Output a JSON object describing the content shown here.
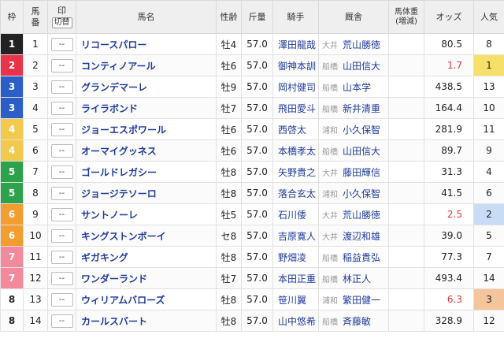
{
  "headers": {
    "waku": "枠",
    "umaban": "馬\n番",
    "mark": "印",
    "toggle": "切替",
    "horse": "馬名",
    "sexage": "性齢",
    "weight": "斤量",
    "jockey": "騎手",
    "trainer": "厩舎",
    "bodyweight": "馬体重\n(増減)",
    "odds": "オッズ",
    "pop": "人気"
  },
  "colors": {
    "waku": [
      "#ffffff",
      "#222222",
      "#e8334a",
      "#e8334a",
      "#2b5fc7",
      "#2b5fc7",
      "#f2c94c",
      "#f2c94c",
      "#2ca24a",
      "#2ca24a",
      "#f39c2f",
      "#f39c2f",
      "#f3899b",
      "#f3899b"
    ],
    "waku_text": [
      "#222222",
      "#ffffff",
      "#ffffff",
      "#ffffff",
      "#ffffff",
      "#ffffff",
      "#ffffff",
      "#ffffff",
      "#ffffff",
      "#ffffff",
      "#ffffff",
      "#ffffff",
      "#ffffff",
      "#ffffff"
    ],
    "pop1": "#f7e06a",
    "pop2": "#c9dcf5",
    "pop3": "#f4c49a"
  },
  "rows": [
    {
      "waku": "1",
      "umaban": "1",
      "mark": "--",
      "horse": "リコースパロー",
      "sexage": "牡4",
      "weight": "57.0",
      "jockey": "澤田龍哉",
      "reg": "大井",
      "trainer": "荒山勝徳",
      "bodyweight": "",
      "odds": "80.5",
      "pop": "8"
    },
    {
      "waku": "2",
      "umaban": "2",
      "mark": "--",
      "horse": "コンティノアール",
      "sexage": "牡6",
      "weight": "57.0",
      "jockey": "御神本訓",
      "reg": "船橋",
      "trainer": "山田信大",
      "bodyweight": "",
      "odds": "1.7",
      "pop": "1"
    },
    {
      "waku": "3",
      "umaban": "3",
      "mark": "--",
      "horse": "グランデマーレ",
      "sexage": "牡9",
      "weight": "57.0",
      "jockey": "岡村健司",
      "reg": "船橋",
      "trainer": "山本学",
      "bodyweight": "",
      "odds": "438.5",
      "pop": "13"
    },
    {
      "waku": "3",
      "umaban": "4",
      "mark": "--",
      "horse": "ライラボンド",
      "sexage": "牡7",
      "weight": "57.0",
      "jockey": "飛田愛斗",
      "reg": "船橋",
      "trainer": "新井清重",
      "bodyweight": "",
      "odds": "164.4",
      "pop": "10"
    },
    {
      "waku": "4",
      "umaban": "5",
      "mark": "--",
      "horse": "ジョーエスポワール",
      "sexage": "牡6",
      "weight": "57.0",
      "jockey": "西啓太",
      "reg": "浦和",
      "trainer": "小久保智",
      "bodyweight": "",
      "odds": "281.9",
      "pop": "11"
    },
    {
      "waku": "4",
      "umaban": "6",
      "mark": "--",
      "horse": "オーマイグッネス",
      "sexage": "牡6",
      "weight": "57.0",
      "jockey": "本橋孝太",
      "reg": "船橋",
      "trainer": "山田信大",
      "bodyweight": "",
      "odds": "89.7",
      "pop": "9"
    },
    {
      "waku": "5",
      "umaban": "7",
      "mark": "--",
      "horse": "ゴールドレガシー",
      "sexage": "牡8",
      "weight": "57.0",
      "jockey": "矢野貴之",
      "reg": "大井",
      "trainer": "藤田輝信",
      "bodyweight": "",
      "odds": "31.3",
      "pop": "4"
    },
    {
      "waku": "5",
      "umaban": "8",
      "mark": "--",
      "horse": "ジョージテソーロ",
      "sexage": "牡8",
      "weight": "57.0",
      "jockey": "落合玄太",
      "reg": "浦和",
      "trainer": "小久保智",
      "bodyweight": "",
      "odds": "41.5",
      "pop": "6"
    },
    {
      "waku": "6",
      "umaban": "9",
      "mark": "--",
      "horse": "サントノーレ",
      "sexage": "牡5",
      "weight": "57.0",
      "jockey": "石川倭",
      "reg": "大井",
      "trainer": "荒山勝徳",
      "bodyweight": "",
      "odds": "2.5",
      "pop": "2"
    },
    {
      "waku": "6",
      "umaban": "10",
      "mark": "--",
      "horse": "キングストンボーイ",
      "sexage": "セ8",
      "weight": "57.0",
      "jockey": "吉原寛人",
      "reg": "大井",
      "trainer": "渡辺和雄",
      "bodyweight": "",
      "odds": "39.0",
      "pop": "5"
    },
    {
      "waku": "7",
      "umaban": "11",
      "mark": "--",
      "horse": "ギガキング",
      "sexage": "牡8",
      "weight": "57.0",
      "jockey": "野畑凌",
      "reg": "船橋",
      "trainer": "稲益貴弘",
      "bodyweight": "",
      "odds": "77.3",
      "pop": "7"
    },
    {
      "waku": "7",
      "umaban": "12",
      "mark": "--",
      "horse": "ワンダーランド",
      "sexage": "牡7",
      "weight": "57.0",
      "jockey": "本田正重",
      "reg": "船橋",
      "trainer": "林正人",
      "bodyweight": "",
      "odds": "493.4",
      "pop": "14"
    },
    {
      "waku": "8",
      "umaban": "13",
      "mark": "--",
      "horse": "ウィリアムバローズ",
      "sexage": "牡8",
      "weight": "57.0",
      "jockey": "笹川翼",
      "reg": "浦和",
      "trainer": "繁田健一",
      "bodyweight": "",
      "odds": "6.3",
      "pop": "3"
    },
    {
      "waku": "8",
      "umaban": "14",
      "mark": "--",
      "horse": "カールスバート",
      "sexage": "牡8",
      "weight": "57.0",
      "jockey": "山中悠希",
      "reg": "船橋",
      "trainer": "斉藤敏",
      "bodyweight": "",
      "odds": "328.9",
      "pop": "12"
    }
  ]
}
